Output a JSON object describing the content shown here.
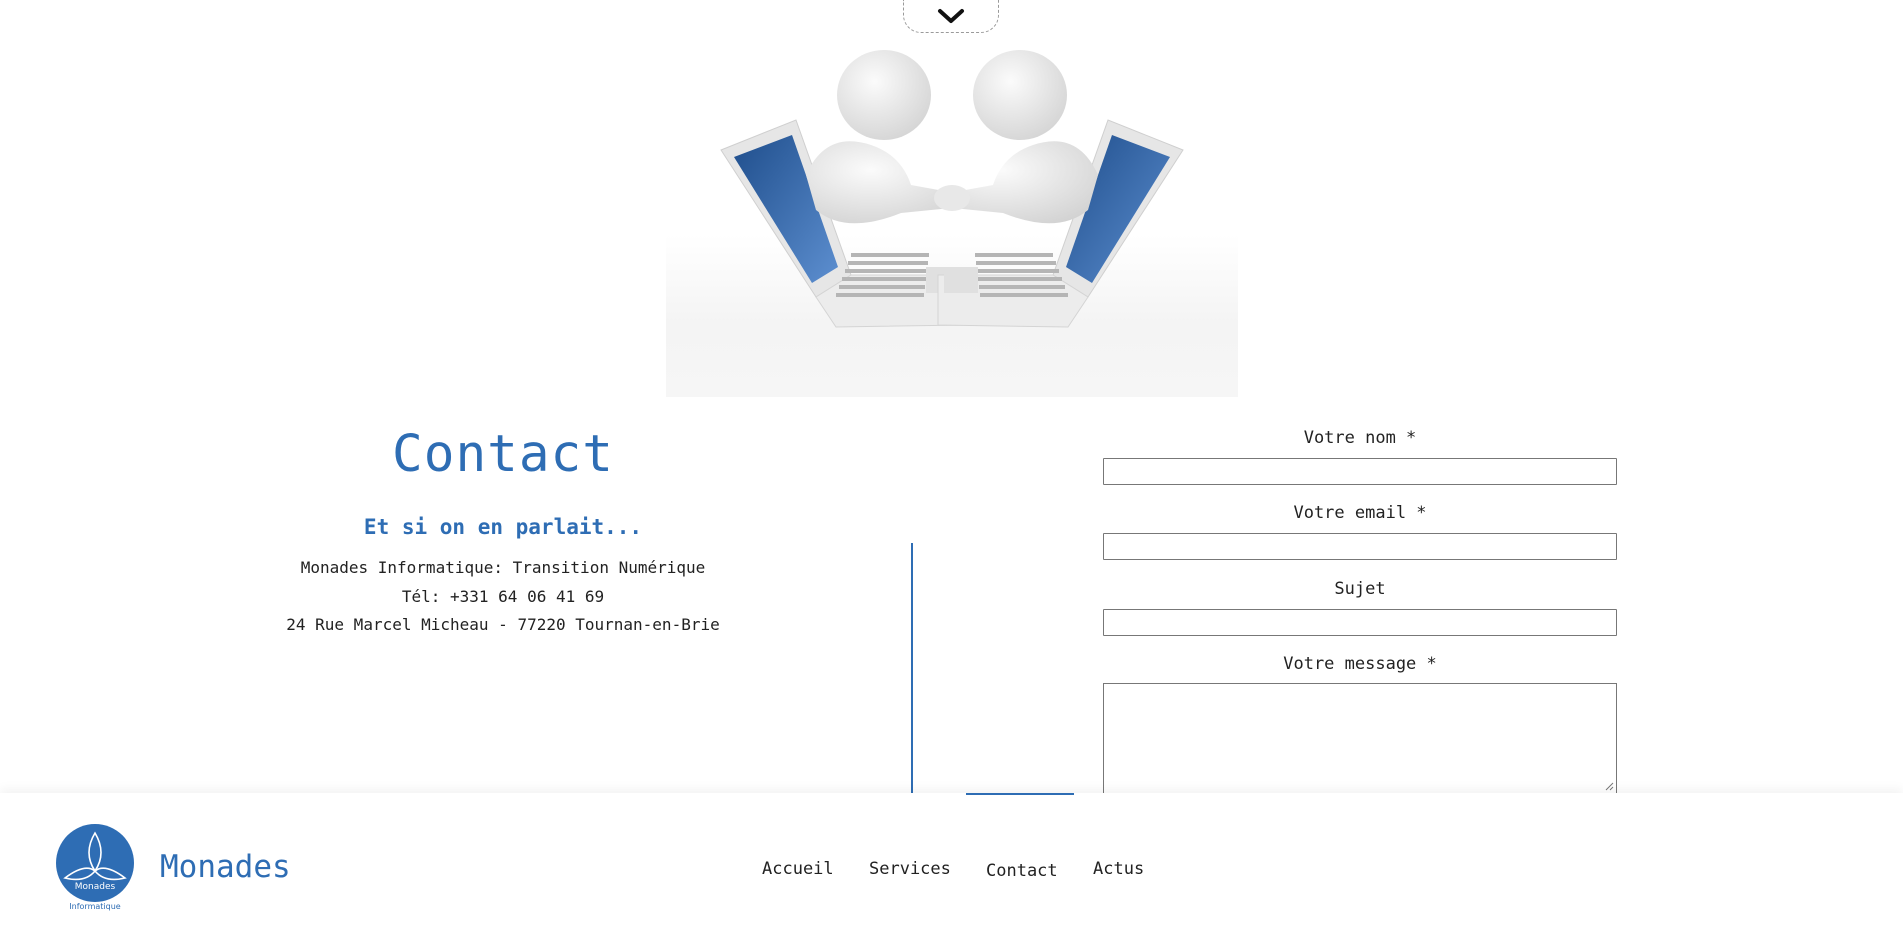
{
  "hero": {
    "image_alt": "two figures shaking hands through laptops"
  },
  "contact": {
    "title": "Contact",
    "subtitle": "Et si on en parlait...",
    "company_line": "Monades Informatique: Transition Numérique",
    "phone_line": "Tél: +331 64 06 41 69",
    "address_line": "24 Rue Marcel Micheau - 77220 Tournan-en-Brie"
  },
  "form": {
    "name_label": "Votre nom *",
    "email_label": "Votre email *",
    "subject_label": "Sujet",
    "message_label": "Votre message *",
    "name_value": "",
    "email_value": "",
    "subject_value": "",
    "message_value": ""
  },
  "footer": {
    "brand": "Monades",
    "logo_text": "Monades",
    "logo_caption": "Informatique",
    "nav": [
      {
        "label": "Accueil",
        "active": false
      },
      {
        "label": "Services",
        "active": false
      },
      {
        "label": "Contact",
        "active": true
      },
      {
        "label": "Actus",
        "active": false
      }
    ]
  },
  "colors": {
    "accent": "#2e6db4",
    "text": "#222222",
    "background": "#ffffff"
  },
  "icons": {
    "scroll": "chevron-down-icon",
    "resize": "resize-grip-icon"
  }
}
